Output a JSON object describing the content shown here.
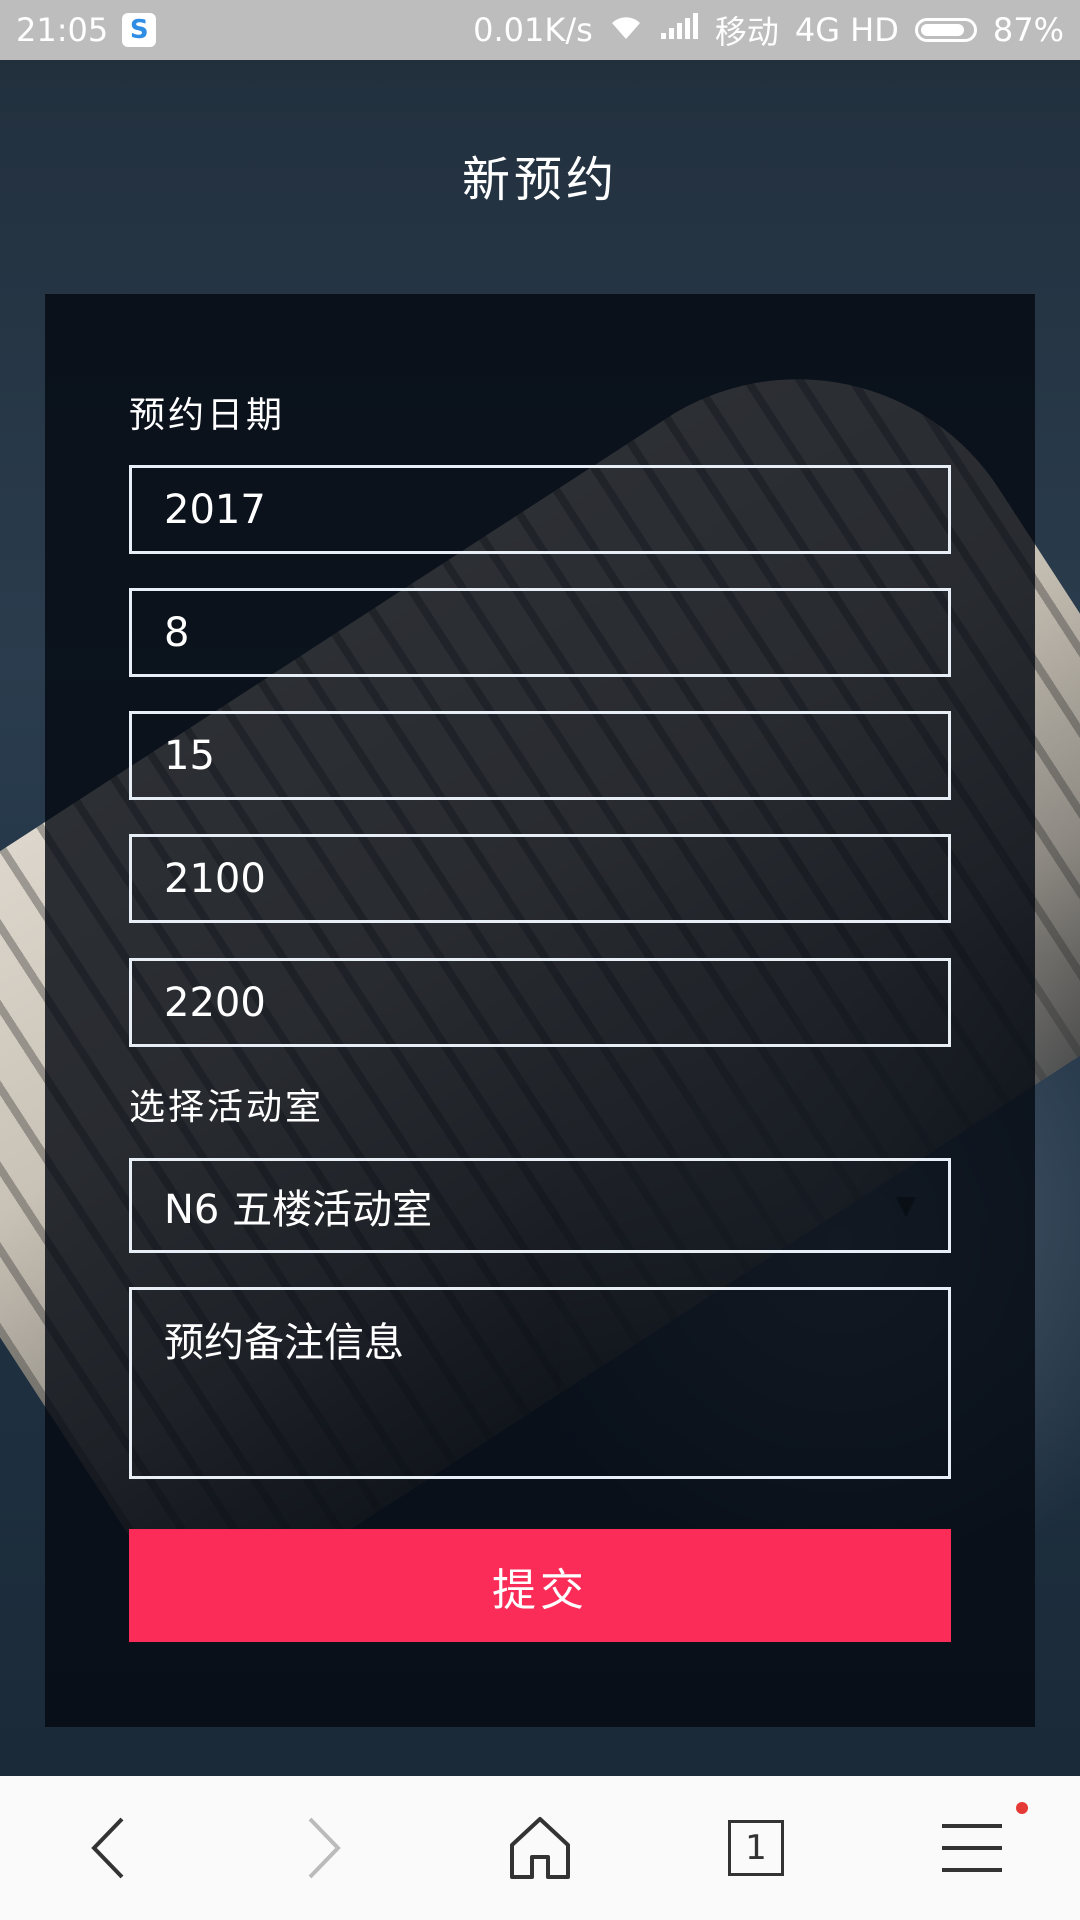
{
  "status_bar": {
    "time": "21:05",
    "net_speed": "0.01K/s",
    "carrier": "移动",
    "network": "4G HD",
    "battery": "87%",
    "battery_level": 0.87,
    "icons": [
      "app-s-icon",
      "wifi-icon",
      "signal-icon",
      "battery-icon"
    ]
  },
  "page": {
    "title": "新预约"
  },
  "form": {
    "date_label": "预约日期",
    "year": "2017",
    "month": "8",
    "day": "15",
    "start_time": "2100",
    "end_time": "2200",
    "room_label": "选择活动室",
    "room_selected": "N6 五楼活动室",
    "remarks_placeholder": "预约备注信息",
    "submit_label": "提交"
  },
  "nav": {
    "tab_count": "1",
    "icons": [
      "back-icon",
      "forward-icon",
      "home-icon",
      "tabs-icon",
      "menu-icon"
    ]
  },
  "colors": {
    "accent": "#fb2d58",
    "status_bar": "#bdbdbd",
    "nav_bg": "#fafafa"
  }
}
